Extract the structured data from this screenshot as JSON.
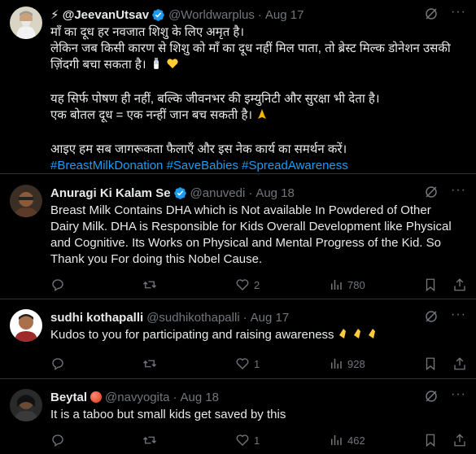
{
  "colors": {
    "background": "#000000",
    "text": "#e7e9ea",
    "muted": "#71767b",
    "link": "#1d9bf0",
    "verified": "#1d9bf0",
    "divider": "#2f3336"
  },
  "tweets": [
    {
      "name": "⚡ @JeevanUtsav",
      "handle": "@Worldwarplus",
      "date": "Aug 17",
      "lines": [
        "माँ का दूध हर नवजात शिशु के लिए अमृत है।",
        "लेकिन जब किसी कारण से शिशु को माँ का दूध नहीं मिल पाता, तो ब्रेस्ट मिल्क डोनेशन उसकी",
        "ज़िंदगी बचा सकता है।",
        "",
        "यह सिर्फ पोषण ही नहीं, बल्कि जीवनभर की इम्युनिटी और सुरक्षा भी देता है।",
        "एक बोतल दूध = एक नन्हीं जान बच सकती है।",
        "",
        "आइए हम सब जागरूकता फैलाएँ और इस नेक कार्य का समर्थन करें।"
      ],
      "hashtags": "#BreastMilkDonation #SaveBabies #SpreadAwareness",
      "icons": [
        "bottle-icon",
        "yellow-heart-icon",
        "folded-hands-icon"
      ]
    },
    {
      "name": "Anuragi Ki Kalam Se",
      "handle": "@anuvedi",
      "date": "Aug 18",
      "lines": [
        "Breast Milk Contains DHA which is Not available In Powdered of Other",
        "Dairy Milk. DHA is Responsible for Kids Overall Development like Physical",
        "and Cognitive. Its Works on Physical and Mental Progress of the Kid. So",
        "Thank you For doing this Nobel Cause."
      ],
      "likes": "2",
      "views": "780"
    },
    {
      "name": "sudhi kothapalli",
      "handle": "@sudhikothapalli",
      "date": "Aug 17",
      "lines": [
        "Kudos to you for participating and raising awareness"
      ],
      "likes": "1",
      "views": "928",
      "icons": [
        "clapping-hands-icon"
      ]
    },
    {
      "name": "Beytal",
      "handle": "@navyogita",
      "date": "Aug 18",
      "lines": [
        "It is a taboo but small kids get saved by this"
      ],
      "likes": "1",
      "views": "462",
      "icons": [
        "red-circle-icon"
      ]
    }
  ]
}
